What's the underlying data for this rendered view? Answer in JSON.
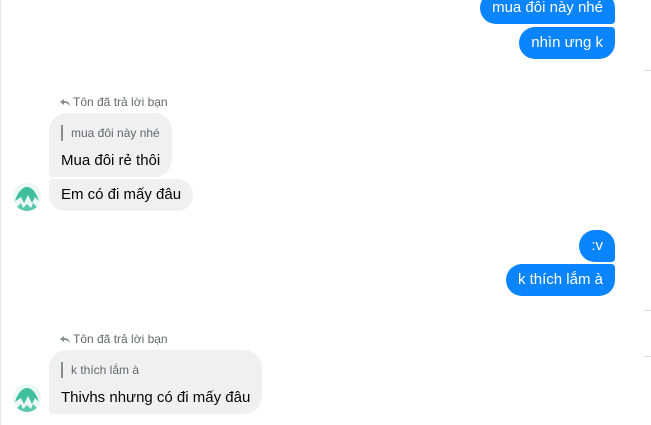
{
  "messages": {
    "sent_1": "mua đôi này nhé",
    "sent_2": "nhìn ưng k",
    "reply_notice_1": "Tôn đã trả lời bạn",
    "quote_1": "mua đôi này nhé",
    "recv_1": "Mua đôi rẻ thôi",
    "recv_2": "Em có đi mấy đâu",
    "sent_3": ":v",
    "sent_4": "k thích lắm à",
    "reply_notice_2": "Tôn đã trả lời bạn",
    "quote_2": "k thích lắm à",
    "recv_3": "Thivhs nhưng có đi mấy đâu"
  },
  "icons": {
    "reply": "reply-arrow-icon",
    "avatar": "contact-avatar"
  },
  "colors": {
    "sent_bubble": "#0a84ff",
    "received_bubble": "#f0f0f0",
    "meta_text": "#65676b"
  }
}
